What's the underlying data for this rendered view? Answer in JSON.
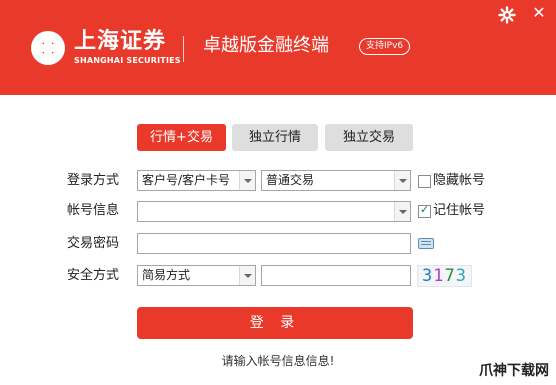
{
  "header": {
    "brand_cn": "上海证券",
    "brand_en": "SHANGHAI SECURITIES",
    "edition": "卓越版金融终端",
    "ipv6_badge": "支持IPv6",
    "settings_icon": "gear-icon",
    "close_icon": "close-icon",
    "close_glyph": "✕",
    "bg_color": "#e8392b"
  },
  "tabs": [
    {
      "label": "行情+交易",
      "active": true
    },
    {
      "label": "独立行情",
      "active": false
    },
    {
      "label": "独立交易",
      "active": false
    }
  ],
  "form": {
    "login_method": {
      "label": "登录方式",
      "account_type": "客户号/客户卡号",
      "trade_type": "普通交易",
      "hide_account": {
        "label": "隐藏帐号",
        "checked": false
      }
    },
    "account": {
      "label": "帐号信息",
      "value": "",
      "remember": {
        "label": "记住帐号",
        "checked": true
      }
    },
    "password": {
      "label": "交易密码",
      "value": "",
      "keyboard_icon": "keyboard-icon"
    },
    "security": {
      "label": "安全方式",
      "method": "简易方式",
      "code_value": "",
      "captcha": [
        "3",
        "1",
        "7",
        "3"
      ]
    }
  },
  "login_button": "登 录",
  "hint": "请输入帐号信息信息!",
  "watermark": "爪神下载网",
  "accent_color": "#e8392b"
}
